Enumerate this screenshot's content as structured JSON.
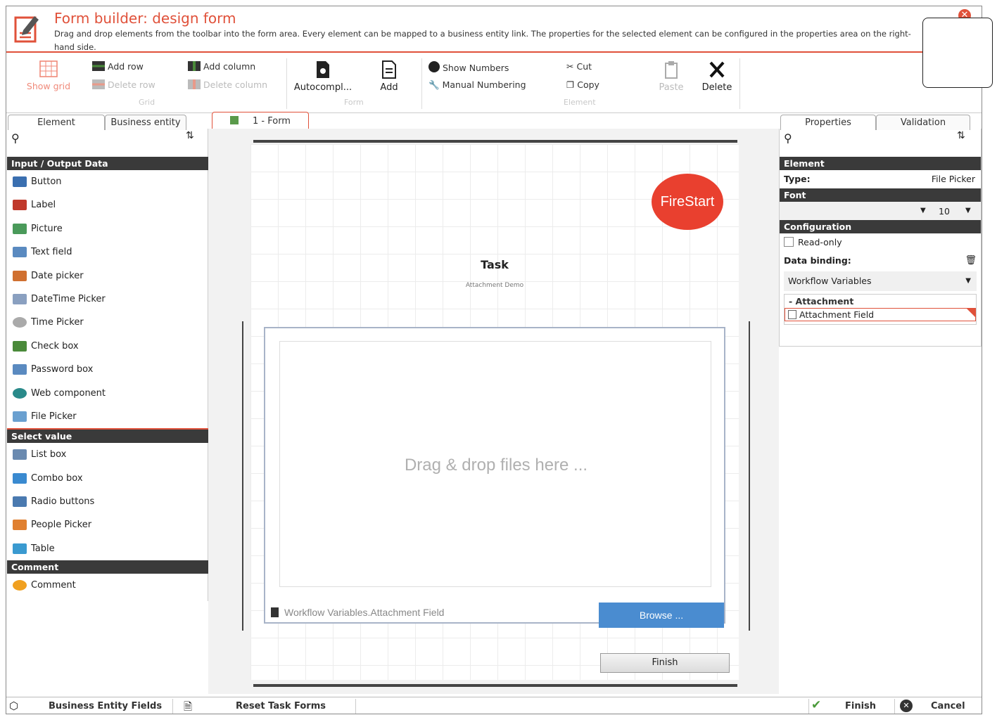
{
  "header": {
    "title": "Form builder: design form",
    "description": "Drag and drop elements from the toolbar into the form area. Every element can be mapped to a business entity link. The properties for the selected element can be configured in the properties area on the right-hand side.",
    "accent": "#e0513a"
  },
  "toolbar": {
    "show_grid": "Show grid",
    "add_row": "Add row",
    "delete_row": "Delete row",
    "add_column": "Add column",
    "delete_column": "Delete column",
    "group_grid": "Grid",
    "autocomplete": "Autocompl...",
    "add": "Add",
    "group_form": "Form",
    "show_numbers": "Show Numbers",
    "manual_numbering": "Manual Numbering",
    "cut": "Cut",
    "copy": "Copy",
    "paste": "Paste",
    "delete": "Delete",
    "group_element": "Element"
  },
  "left_panel": {
    "tabs": [
      "Element",
      "Business entity"
    ],
    "categories": [
      {
        "name": "Input / Output Data",
        "items": [
          {
            "label": "Button",
            "icon": "button-icon"
          },
          {
            "label": "Label",
            "icon": "label-icon"
          },
          {
            "label": "Picture",
            "icon": "picture-icon"
          },
          {
            "label": "Text field",
            "icon": "text-field-icon"
          },
          {
            "label": "Date picker",
            "icon": "calendar-icon"
          },
          {
            "label": "DateTime Picker",
            "icon": "datetime-icon"
          },
          {
            "label": "Time Picker",
            "icon": "clock-icon"
          },
          {
            "label": "Check box",
            "icon": "checkbox-icon"
          },
          {
            "label": "Password box",
            "icon": "password-icon"
          },
          {
            "label": "Web component",
            "icon": "globe-icon"
          },
          {
            "label": "File Picker",
            "icon": "file-picker-icon"
          }
        ]
      },
      {
        "name": "Select value",
        "items": [
          {
            "label": "List box",
            "icon": "list-box-icon"
          },
          {
            "label": "Combo box",
            "icon": "combo-box-icon"
          },
          {
            "label": "Radio buttons",
            "icon": "radio-icon"
          },
          {
            "label": "People Picker",
            "icon": "person-icon"
          },
          {
            "label": "Table",
            "icon": "table-icon"
          }
        ]
      },
      {
        "name": "Comment",
        "items": [
          {
            "label": "Comment",
            "icon": "comment-icon"
          }
        ]
      }
    ]
  },
  "form_tab": {
    "label": "1 - Form"
  },
  "form": {
    "logo_text": "FireStart",
    "title": "Task",
    "subtitle": "Attachment Demo",
    "drop_text": "Drag & drop files here ...",
    "file_binding": "Workflow Variables.Attachment Field",
    "browse": "Browse ...",
    "finish": "Finish"
  },
  "right_panel": {
    "tabs": [
      "Properties",
      "Validation"
    ],
    "element_cat": "Element",
    "type_label": "Type:",
    "type_value": "File Picker",
    "font_cat": "Font",
    "font_size": "10",
    "config_cat": "Configuration",
    "readonly": "Read-only",
    "data_binding": "Data binding:",
    "binding_source": "Workflow Variables",
    "tree_parent": "Attachment",
    "tree_child": "Attachment Field"
  },
  "statusbar": {
    "business_entity_fields": "Business Entity Fields",
    "reset_task_forms": "Reset Task Forms",
    "finish": "Finish",
    "cancel": "Cancel"
  }
}
